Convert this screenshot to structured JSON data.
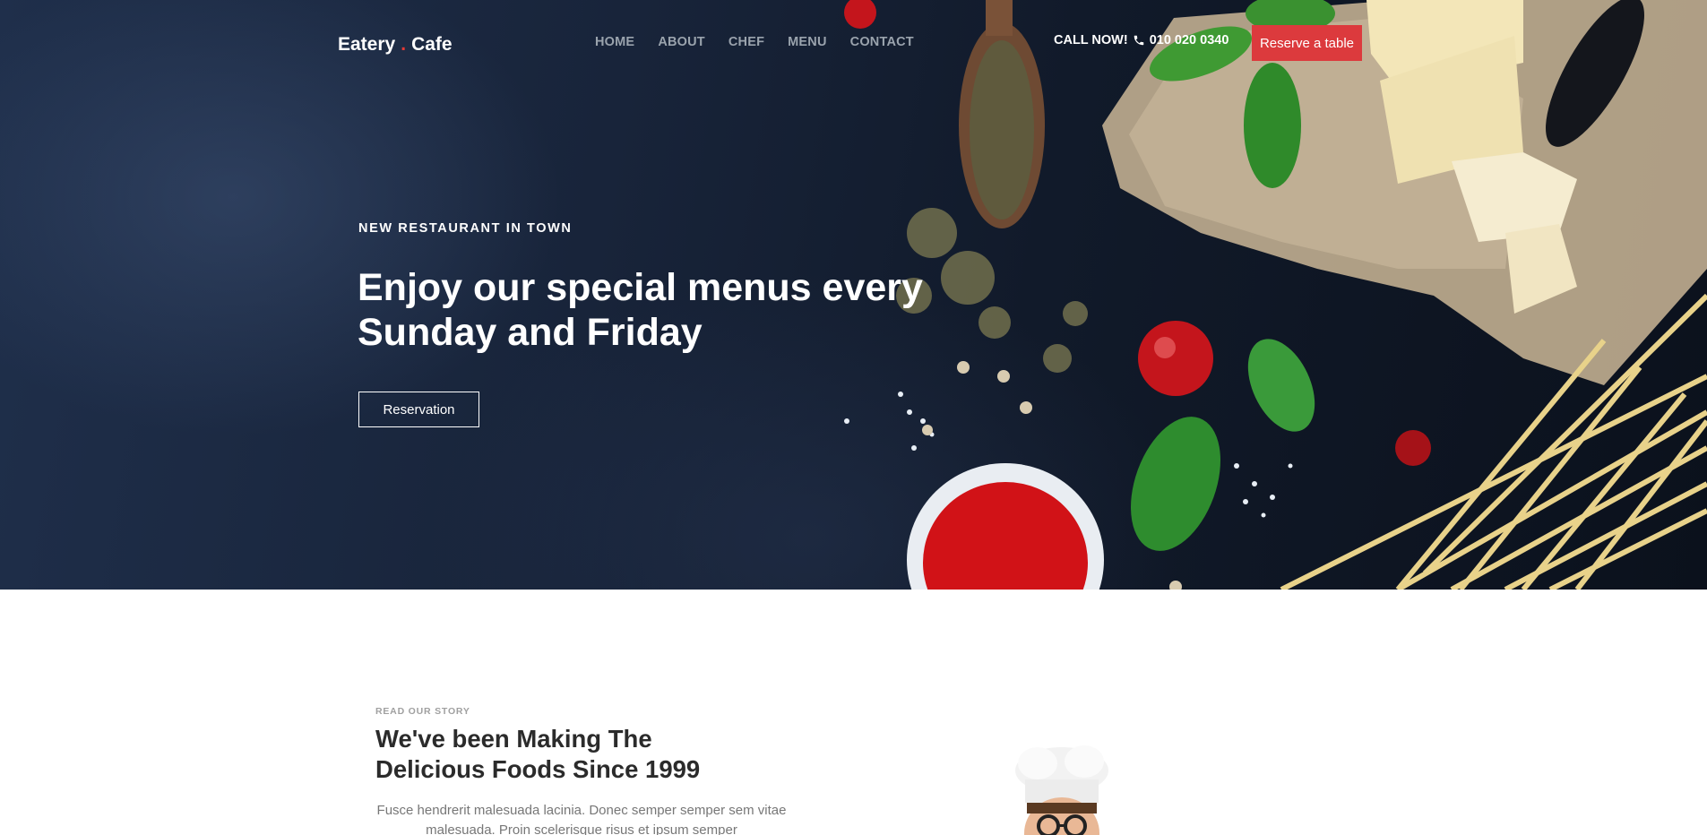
{
  "nav": {
    "logo_left": "Eatery",
    "logo_dot": ".",
    "logo_right": "Cafe",
    "items": [
      {
        "label": "HOME"
      },
      {
        "label": "ABOUT"
      },
      {
        "label": "CHEF"
      },
      {
        "label": "MENU"
      },
      {
        "label": "CONTACT"
      }
    ],
    "call_label": "CALL NOW!",
    "phone_number": "010 020 0340",
    "phone_icon": "phone-icon",
    "reserve_label": "Reserve a table"
  },
  "hero": {
    "eyebrow": "NEW RESTAURANT IN TOWN",
    "headline_line1": "Enjoy our special menus every",
    "headline_line2": "Sunday and Friday",
    "button_label": "Reservation"
  },
  "story": {
    "kicker": "READ OUR STORY",
    "title_line1": "We've been Making The",
    "title_line2": "Delicious Foods Since 1999",
    "text": "Fusce hendrerit malesuada lacinia. Donec semper semper sem vitae malesuada. Proin scelerisque risus et ipsum semper"
  },
  "colors": {
    "accent": "#dc3a3d",
    "hero_bg": "#18243a",
    "nav_link": "#9aa3ad",
    "story_text": "#777777"
  }
}
